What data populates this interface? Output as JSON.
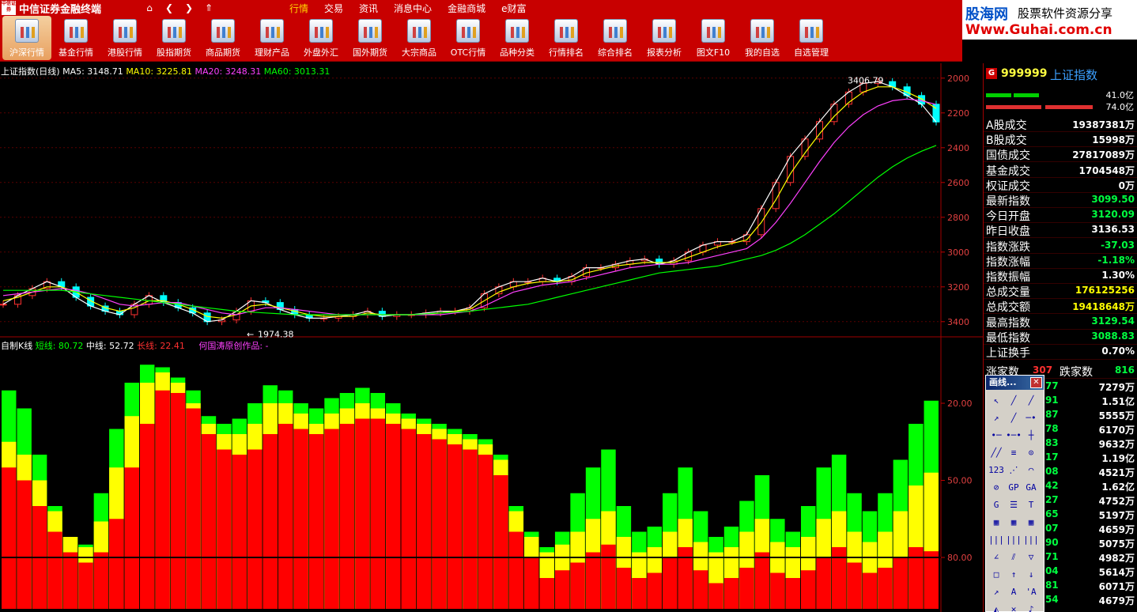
{
  "app": {
    "title": "中信证券金融终端",
    "logo_text": "中信证券"
  },
  "nav": {
    "home_icon": "home-icon",
    "back_icon": "chevron-left-icon",
    "forward_icon": "chevron-right-icon",
    "up_icon": "double-chevron-up-icon"
  },
  "menu": [
    "行情",
    "交易",
    "资讯",
    "消息中心",
    "金融商城",
    "e财富"
  ],
  "toolbar": [
    {
      "label": "沪深行情",
      "active": true
    },
    {
      "label": "基金行情"
    },
    {
      "label": "港股行情"
    },
    {
      "label": "股指期货"
    },
    {
      "label": "商品期货"
    },
    {
      "label": "理财产品"
    },
    {
      "label": "外盘外汇"
    },
    {
      "label": "国外期货"
    },
    {
      "label": "大宗商品"
    },
    {
      "label": "OTC行情"
    },
    {
      "label": "品种分类"
    },
    {
      "label": "行情排名"
    },
    {
      "label": "综合排名"
    },
    {
      "label": "报表分析"
    },
    {
      "label": "图文F10"
    },
    {
      "label": "我的自选"
    },
    {
      "label": "自选管理"
    }
  ],
  "brand": {
    "name": "股海网",
    "slogan": "股票软件资源分享",
    "url": "Www.Guhai.com.cn"
  },
  "price_chart": {
    "title": "上证指数(日线)",
    "ma5": "MA5: 3148.71",
    "ma10": "MA10: 3225.81",
    "ma20": "MA20: 3248.31",
    "ma60": "MA60: 3013.31",
    "high_label": "3406.79",
    "low_label": "1974.38",
    "y_ticks": [
      "3400",
      "3200",
      "3000",
      "2800",
      "2600",
      "2400",
      "2200",
      "2000"
    ],
    "colors": {
      "ma5": "#ffffff",
      "ma10": "#ffff00",
      "ma20": "#ff40ff",
      "ma60": "#00ff00",
      "up": "#ff3030",
      "down": "#00ffff"
    }
  },
  "indicator": {
    "title": "自制K线",
    "short": "短线: 80.72",
    "mid": "中线: 52.72",
    "long": "长线: 22.41",
    "author": "何国涛原创作品: -",
    "y_ticks": [
      "80.00",
      "50.00",
      "20.00"
    ],
    "colors": {
      "short": "#00ff00",
      "mid": "#ffff00",
      "long": "#ff0000"
    }
  },
  "chart_data": [
    {
      "type": "line",
      "title": "上证指数(日线)",
      "ylim": [
        1940,
        3440
      ],
      "y_ticks": [
        2000,
        2200,
        2400,
        2600,
        2800,
        3000,
        3200,
        3400
      ],
      "series": [
        {
          "name": "MA5",
          "values": [
            2100,
            2150,
            2190,
            2230,
            2200,
            2140,
            2090,
            2060,
            2040,
            2100,
            2150,
            2110,
            2080,
            2050,
            2000,
            2010,
            2060,
            2120,
            2110,
            2070,
            2040,
            2020,
            2020,
            2030,
            2040,
            2060,
            2030,
            2040,
            2040,
            2050,
            2060,
            2060,
            2080,
            2160,
            2200,
            2230,
            2230,
            2250,
            2230,
            2260,
            2310,
            2310,
            2330,
            2350,
            2360,
            2330,
            2350,
            2400,
            2440,
            2460,
            2460,
            2500,
            2650,
            2800,
            2950,
            3050,
            3150,
            3250,
            3320,
            3370,
            3380,
            3350,
            3300,
            3250,
            3148
          ]
        },
        {
          "name": "MA10",
          "values": [
            2120,
            2140,
            2170,
            2200,
            2200,
            2170,
            2120,
            2080,
            2060,
            2080,
            2120,
            2120,
            2100,
            2070,
            2030,
            2020,
            2040,
            2090,
            2100,
            2080,
            2060,
            2040,
            2030,
            2030,
            2030,
            2050,
            2040,
            2040,
            2040,
            2040,
            2050,
            2060,
            2070,
            2120,
            2170,
            2200,
            2220,
            2230,
            2230,
            2240,
            2280,
            2300,
            2320,
            2330,
            2340,
            2340,
            2340,
            2370,
            2400,
            2430,
            2450,
            2470,
            2570,
            2700,
            2850,
            2970,
            3080,
            3180,
            3260,
            3320,
            3350,
            3350,
            3320,
            3280,
            3225
          ]
        },
        {
          "name": "MA20",
          "values": [
            2150,
            2160,
            2170,
            2180,
            2190,
            2180,
            2160,
            2130,
            2100,
            2090,
            2100,
            2110,
            2110,
            2090,
            2070,
            2050,
            2040,
            2060,
            2080,
            2080,
            2070,
            2060,
            2050,
            2040,
            2040,
            2040,
            2040,
            2040,
            2040,
            2040,
            2040,
            2050,
            2060,
            2090,
            2130,
            2170,
            2190,
            2210,
            2220,
            2230,
            2250,
            2270,
            2290,
            2310,
            2320,
            2330,
            2330,
            2340,
            2360,
            2380,
            2400,
            2420,
            2480,
            2570,
            2680,
            2800,
            2920,
            3030,
            3120,
            3190,
            3240,
            3270,
            3280,
            3270,
            3248
          ]
        },
        {
          "name": "MA60",
          "values": [
            2180,
            2180,
            2180,
            2180,
            2180,
            2170,
            2160,
            2150,
            2140,
            2130,
            2120,
            2110,
            2100,
            2090,
            2080,
            2070,
            2060,
            2055,
            2050,
            2045,
            2040,
            2040,
            2040,
            2040,
            2040,
            2040,
            2040,
            2040,
            2040,
            2045,
            2050,
            2055,
            2060,
            2070,
            2080,
            2090,
            2100,
            2120,
            2140,
            2160,
            2180,
            2200,
            2220,
            2240,
            2260,
            2280,
            2290,
            2300,
            2310,
            2320,
            2340,
            2360,
            2380,
            2410,
            2450,
            2500,
            2560,
            2620,
            2690,
            2760,
            2830,
            2890,
            2940,
            2980,
            3013
          ]
        }
      ]
    },
    {
      "type": "bar",
      "title": "自制K线",
      "ylim": [
        0,
        100
      ],
      "y_ticks": [
        20,
        50,
        80
      ],
      "series": [
        {
          "name": "短线",
          "values": [
            85,
            78,
            60,
            40,
            28,
            25,
            45,
            70,
            88,
            95,
            94,
            90,
            85,
            75,
            72,
            74,
            80,
            87,
            85,
            80,
            78,
            82,
            84,
            86,
            84,
            80,
            76,
            74,
            72,
            70,
            68,
            66,
            60,
            40,
            30,
            24,
            30,
            45,
            55,
            62,
            40,
            30,
            32,
            45,
            55,
            38,
            28,
            32,
            42,
            52,
            35,
            30,
            40,
            55,
            60,
            45,
            38,
            45,
            58,
            72,
            81
          ]
        },
        {
          "name": "中线",
          "values": [
            65,
            60,
            50,
            38,
            28,
            24,
            34,
            55,
            75,
            88,
            92,
            88,
            80,
            72,
            68,
            68,
            72,
            80,
            80,
            76,
            72,
            76,
            78,
            80,
            78,
            76,
            74,
            72,
            70,
            68,
            66,
            64,
            58,
            38,
            28,
            22,
            25,
            30,
            35,
            38,
            28,
            22,
            24,
            30,
            35,
            26,
            22,
            24,
            30,
            35,
            26,
            24,
            28,
            35,
            38,
            30,
            26,
            30,
            38,
            48,
            53
          ]
        },
        {
          "name": "长线",
          "values": [
            55,
            50,
            40,
            30,
            22,
            18,
            22,
            35,
            55,
            72,
            85,
            84,
            78,
            68,
            62,
            60,
            62,
            68,
            72,
            70,
            68,
            70,
            72,
            74,
            74,
            72,
            70,
            68,
            66,
            64,
            62,
            60,
            52,
            30,
            20,
            12,
            15,
            18,
            22,
            25,
            16,
            12,
            14,
            20,
            24,
            15,
            10,
            12,
            16,
            22,
            14,
            12,
            15,
            20,
            24,
            18,
            14,
            16,
            20,
            24,
            22.41
          ]
        }
      ]
    }
  ],
  "info": {
    "g_label": "G",
    "code": "999999",
    "name": "上证指数",
    "bar1_label": "41.0亿",
    "bar2_label": "74.0亿",
    "rows": [
      {
        "k": "A股成交",
        "v": "19387381万",
        "c": "#ffffff"
      },
      {
        "k": "B股成交",
        "v": "15998万",
        "c": "#ffffff"
      },
      {
        "k": "国债成交",
        "v": "27817089万",
        "c": "#ffffff"
      },
      {
        "k": "基金成交",
        "v": "1704548万",
        "c": "#ffffff"
      },
      {
        "k": "权证成交",
        "v": "0万",
        "c": "#ffffff"
      },
      {
        "k": "最新指数",
        "v": "3099.50",
        "c": "#00ff40"
      },
      {
        "k": "今日开盘",
        "v": "3120.09",
        "c": "#00ff40"
      },
      {
        "k": "昨日收盘",
        "v": "3136.53",
        "c": "#ffffff"
      },
      {
        "k": "指数涨跌",
        "v": "-37.03",
        "c": "#00ff40"
      },
      {
        "k": "指数涨幅",
        "v": "-1.18%",
        "c": "#00ff40"
      },
      {
        "k": "指数振幅",
        "v": "1.30%",
        "c": "#ffffff"
      },
      {
        "k": "总成交量",
        "v": "176125256",
        "c": "#ffff00"
      },
      {
        "k": "总成交额",
        "v": "19418648万",
        "c": "#ffff00"
      },
      {
        "k": "最高指数",
        "v": "3129.54",
        "c": "#00ff40"
      },
      {
        "k": "最低指数",
        "v": "3088.83",
        "c": "#00ff40"
      },
      {
        "k": "上证换手",
        "v": "0.70%",
        "c": "#ffffff"
      }
    ],
    "updown": {
      "up_label": "涨家数",
      "up_value": "307",
      "down_label": "跌家数",
      "down_value": "816"
    },
    "ticks": [
      {
        "p": "3099.77",
        "v": "7279万"
      },
      {
        "p": "3098.91",
        "v": "1.51亿"
      },
      {
        "p": "3099.87",
        "v": "5555万"
      },
      {
        "p": "3099.78",
        "v": "6170万"
      },
      {
        "p": "3099.83",
        "v": "9632万"
      },
      {
        "p": "3099.17",
        "v": "1.19亿"
      },
      {
        "p": "3099.08",
        "v": "4521万"
      },
      {
        "p": "3099.42",
        "v": "1.62亿"
      },
      {
        "p": "3100.27",
        "v": "4752万"
      },
      {
        "p": "3098.65",
        "v": "5197万"
      },
      {
        "p": "3099.07",
        "v": "4659万"
      },
      {
        "p": "3099.90",
        "v": "5075万"
      },
      {
        "p": "3099.71",
        "v": "4982万"
      },
      {
        "p": "3099.04",
        "v": "5614万"
      },
      {
        "p": "3098.81",
        "v": "6071万"
      },
      {
        "p": "3099.54",
        "v": "4679万"
      }
    ]
  },
  "draw_panel": {
    "title": "画线...",
    "close": "✕",
    "tools": [
      "↖",
      "╱",
      "╱",
      "↗",
      "╱",
      "─•",
      "•─",
      "•─•",
      "┼",
      "╱╱",
      "≡",
      "⊙",
      "123",
      "⋰",
      "◠",
      "⊘",
      "GP",
      "GA",
      "G",
      "☰",
      "T",
      "▦",
      "▦",
      "▦",
      "|||",
      "|||",
      "|||",
      "∠",
      "⫽",
      "▽",
      "□",
      "↑",
      "↓",
      "↗",
      "A",
      "'A",
      "◭",
      "✕",
      "♪"
    ]
  }
}
